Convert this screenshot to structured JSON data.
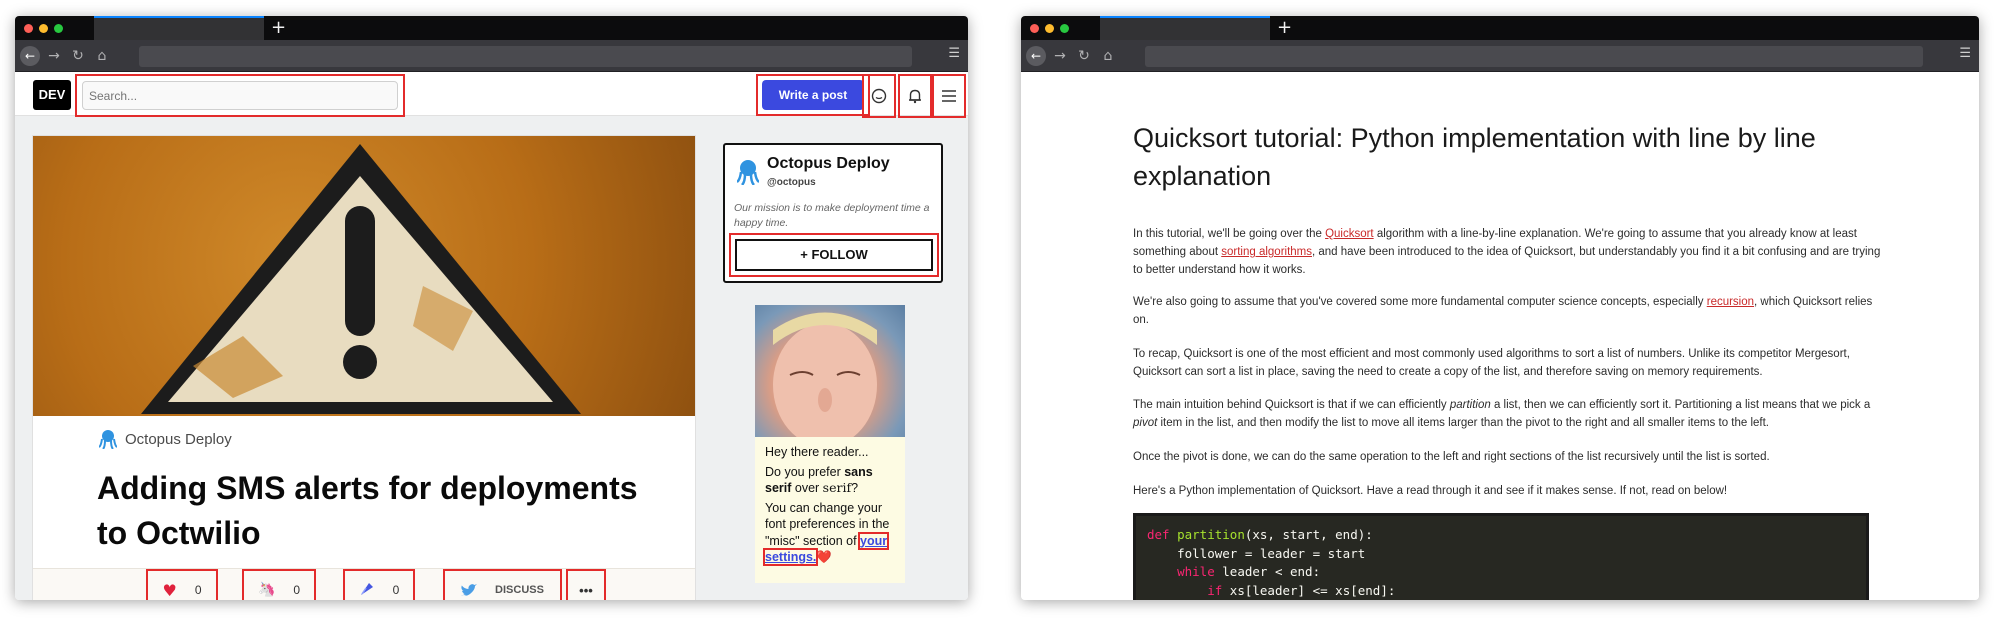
{
  "left_window": {
    "header": {
      "logo": "DEV",
      "search_placeholder": "Search...",
      "write_post": "Write a post",
      "icons": [
        "chat-icon",
        "bell-icon",
        "menu-icon"
      ]
    },
    "article": {
      "org_name": "Octopus Deploy",
      "title": "Adding SMS alerts for deployments to Octwilio",
      "reactions": {
        "heart_count": "0",
        "unicorn_count": "0",
        "bookmark_count": "0",
        "discuss_label": "DISCUSS",
        "more_label": "•••"
      }
    },
    "org_card": {
      "name": "Octopus Deploy",
      "handle": "@octopus",
      "mission": "Our mission is to make deployment time a happy time.",
      "follow_label": "+ FOLLOW"
    },
    "sponsor": {
      "greeting": "Hey there reader...",
      "q_prefix": "Do you prefer ",
      "q_sans": "sans serif",
      "q_over": " over ",
      "q_serif": "serif",
      "q_end": "?",
      "change_prefix": "You can change your font preferences in the \"misc\" section of ",
      "settings_link": "your settings.",
      "heart": "❤️"
    }
  },
  "right_window": {
    "title": "Quicksort tutorial: Python implementation with line by line explanation",
    "p1_a": "In this tutorial, we'll be going over the ",
    "p1_link1": "Quicksort",
    "p1_b": " algorithm with a line-by-line explanation. We're going to assume that you already know at least something about ",
    "p1_link2": "sorting algorithms",
    "p1_c": ", and have been introduced to the idea of Quicksort, but understandably you find it a bit confusing and are trying to better understand how it works.",
    "p2_a": "We're also going to assume that you've covered some more fundamental computer science concepts, especially ",
    "p2_link": "recursion",
    "p2_b": ", which Quicksort relies on.",
    "p3": "To recap, Quicksort is one of the most efficient and most commonly used algorithms to sort a list of numbers. Unlike its competitor Mergesort, Quicksort can sort a list in place, saving the need to create a copy of the list, and therefore saving on memory requirements.",
    "p4_a": "The main intuition behind Quicksort is that if we can efficiently ",
    "p4_em1": "partition",
    "p4_b": " a list, then we can efficiently sort it. Partitioning a list means that we pick a ",
    "p4_em2": "pivot",
    "p4_c": " item in the list, and then modify the list to move all items larger than the pivot to the right and all smaller items to the left.",
    "p5": "Once the pivot is done, we can do the same operation to the left and right sections of the list recursively until the list is sorted.",
    "p6": "Here's a Python implementation of Quicksort. Have a read through it and see if it makes sense. If not, read on below!",
    "code": {
      "l1_kw": "def",
      "l1_fn": "partition",
      "l1_rest": "(xs, start, end):",
      "l2": "    follower = leader = start",
      "l3_kw": "while",
      "l3_rest": " leader < end:",
      "l4_kw": "if",
      "l4_rest": " xs[leader] <= xs[end]:"
    }
  }
}
